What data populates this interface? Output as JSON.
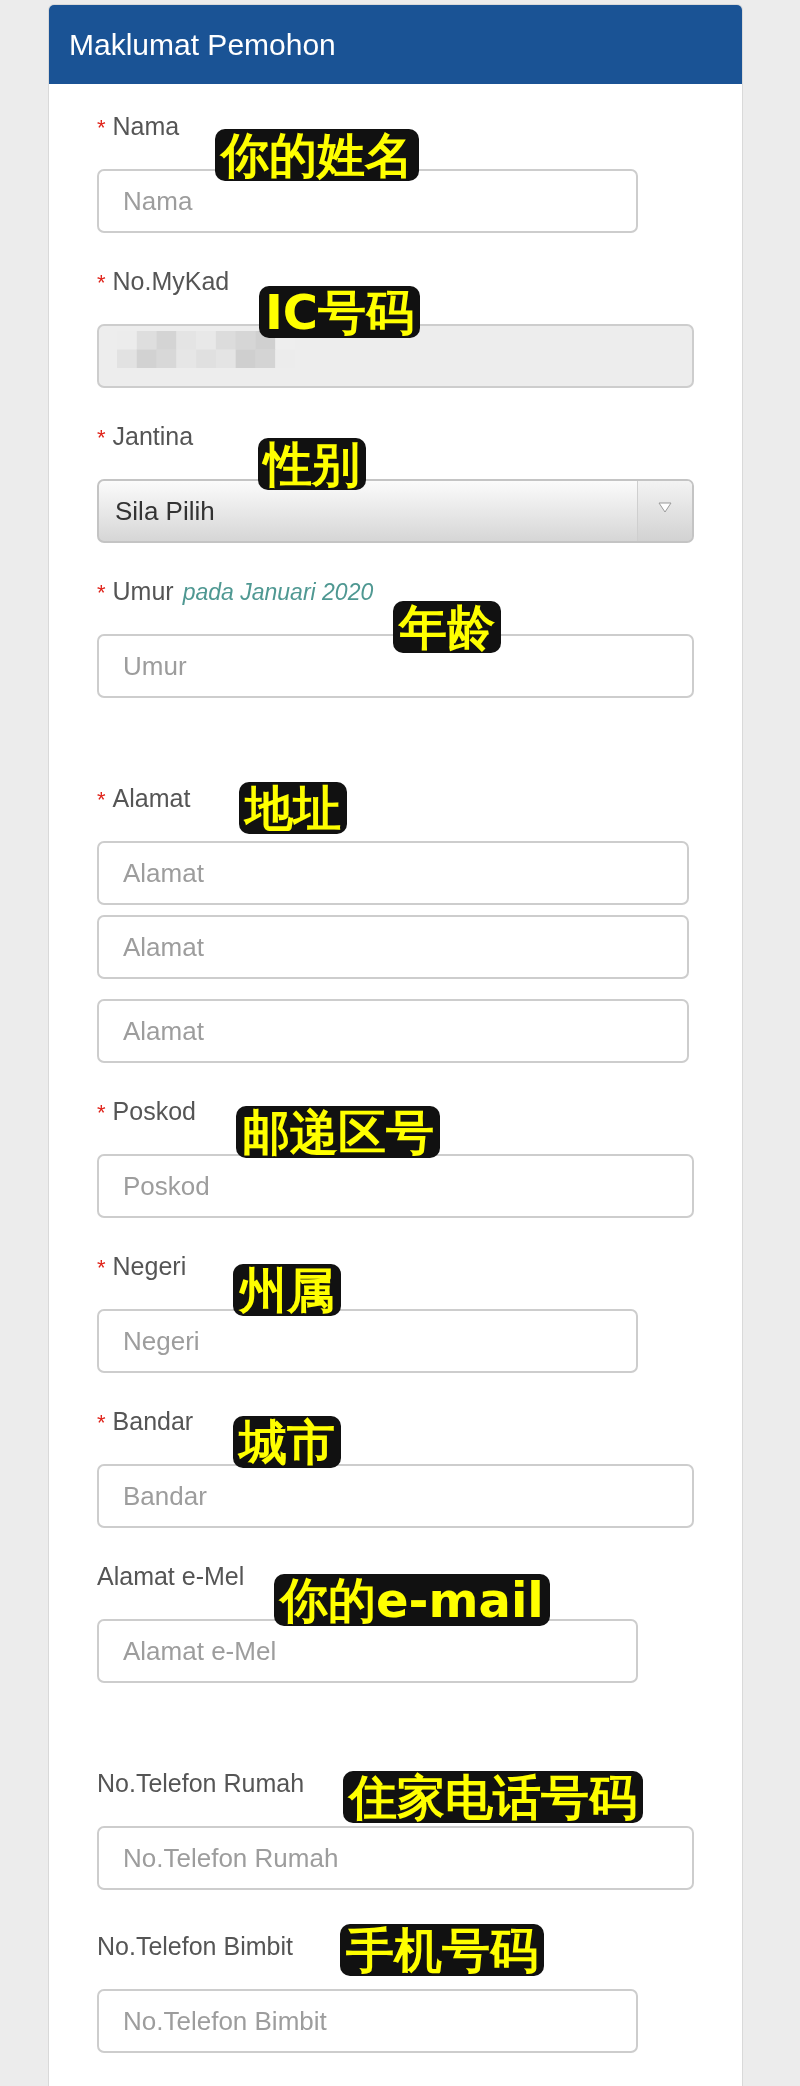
{
  "panel": {
    "title": "Maklumat Pemohon"
  },
  "fields": [
    {
      "kind": "input",
      "marker": "*",
      "label": "Nama",
      "annotation": "你的姓名",
      "inputs": [
        {
          "kind": "text",
          "placeholder": "Nama",
          "disabled": false
        }
      ]
    },
    {
      "kind": "input",
      "marker": "*",
      "label": "No.MyKad",
      "annotation": "IC号码",
      "inputs": [
        {
          "kind": "redacted",
          "disabled": true
        }
      ]
    },
    {
      "kind": "select",
      "marker": "*",
      "label": "Jantina",
      "annotation": "性别",
      "value": "Sila Pilih"
    },
    {
      "kind": "input",
      "marker": "*",
      "label": "Umur",
      "hint": "pada Januari 2020",
      "annotation": "年龄",
      "inputs": [
        {
          "kind": "text",
          "placeholder": "Umur",
          "disabled": false
        }
      ]
    },
    {
      "kind": "input",
      "marker": "*",
      "label": "Alamat",
      "annotation": "地址",
      "inputs": [
        {
          "kind": "text",
          "placeholder": "Alamat",
          "disabled": false
        },
        {
          "kind": "text",
          "placeholder": "Alamat",
          "disabled": false
        },
        {
          "kind": "text",
          "placeholder": "Alamat",
          "disabled": false
        }
      ]
    },
    {
      "kind": "input",
      "marker": "*",
      "label": "Poskod",
      "annotation": "邮递区号",
      "inputs": [
        {
          "kind": "text",
          "placeholder": "Poskod",
          "disabled": false
        }
      ]
    },
    {
      "kind": "input",
      "marker": "*",
      "label": "Negeri",
      "annotation": "州属",
      "inputs": [
        {
          "kind": "text",
          "placeholder": "Negeri",
          "disabled": false
        }
      ]
    },
    {
      "kind": "input",
      "marker": "*",
      "label": "Bandar",
      "annotation": "城市",
      "inputs": [
        {
          "kind": "text",
          "placeholder": "Bandar",
          "disabled": false
        }
      ]
    },
    {
      "kind": "input",
      "label": "Alamat e-Mel",
      "annotation": "你的e-mail",
      "inputs": [
        {
          "kind": "text",
          "placeholder": "Alamat e-Mel",
          "disabled": false
        }
      ]
    },
    {
      "kind": "input",
      "label": "No.Telefon Rumah",
      "annotation": "住家电话号码",
      "inputs": [
        {
          "kind": "text",
          "placeholder": "No.Telefon Rumah",
          "disabled": false
        }
      ]
    },
    {
      "kind": "input",
      "label": "No.Telefon Bimbit",
      "annotation": "手机号码",
      "inputs": [
        {
          "kind": "text",
          "placeholder": "No.Telefon Bimbit",
          "disabled": false
        }
      ]
    }
  ]
}
